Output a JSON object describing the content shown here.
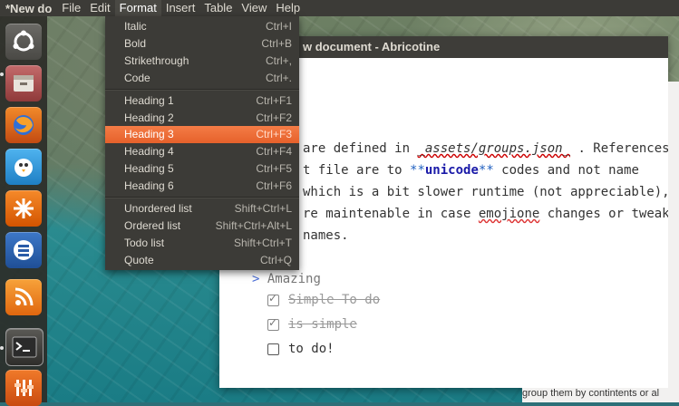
{
  "menubar": {
    "app_title": "*New do",
    "menus": [
      "File",
      "Edit",
      "Format",
      "Insert",
      "Table",
      "View",
      "Help"
    ]
  },
  "launcher": {
    "items": [
      "ubuntu-icon",
      "files-icon",
      "firefox-icon",
      "bird-icon",
      "star-icon",
      "stack-icon",
      "rss-icon",
      "terminal-icon",
      "equalizer-icon"
    ]
  },
  "window": {
    "title": "w document - Abricotine"
  },
  "editor": {
    "line1_a": "are defined in ",
    "line1_em": "_assets/groups.json_",
    "line1_b": " . References",
    "line2_a": "t file are to ",
    "line2_strong_open": "**",
    "line2_strong": "unicode",
    "line2_strong_close": "**",
    "line2_b": " codes and not name",
    "line3": "which is a bit slower runtime (not appreciable),",
    "line4_a": "re maintenable in case ",
    "line4_spell": "emojione",
    "line4_b": " changes or tweaks",
    "line5": "names.",
    "quote_mark": ">",
    "quote_text": "Amazing",
    "tasks": [
      {
        "text": "Simple To do",
        "done": true
      },
      {
        "text": "is simple",
        "done": true
      },
      {
        "text": "to do!",
        "done": false
      }
    ]
  },
  "bottom_peek": "group them by contintents or al",
  "format_menu": {
    "items": [
      {
        "label": "Italic",
        "shortcut": "Ctrl+I"
      },
      {
        "label": "Bold",
        "shortcut": "Ctrl+B"
      },
      {
        "label": "Strikethrough",
        "shortcut": "Ctrl+,"
      },
      {
        "label": "Code",
        "shortcut": "Ctrl+."
      },
      {
        "label": "Heading 1",
        "shortcut": "Ctrl+F1"
      },
      {
        "label": "Heading 2",
        "shortcut": "Ctrl+F2"
      },
      {
        "label": "Heading 3",
        "shortcut": "Ctrl+F3"
      },
      {
        "label": "Heading 4",
        "shortcut": "Ctrl+F4"
      },
      {
        "label": "Heading 5",
        "shortcut": "Ctrl+F5"
      },
      {
        "label": "Heading 6",
        "shortcut": "Ctrl+F6"
      },
      {
        "label": "Unordered list",
        "shortcut": "Shift+Ctrl+L"
      },
      {
        "label": "Ordered list",
        "shortcut": "Shift+Ctrl+Alt+L"
      },
      {
        "label": "Todo list",
        "shortcut": "Shift+Ctrl+T"
      },
      {
        "label": "Quote",
        "shortcut": "Ctrl+Q"
      }
    ],
    "highlighted": "Heading 3"
  },
  "colors": {
    "accent": "#e6612b",
    "menubar": "#3c3b37"
  }
}
